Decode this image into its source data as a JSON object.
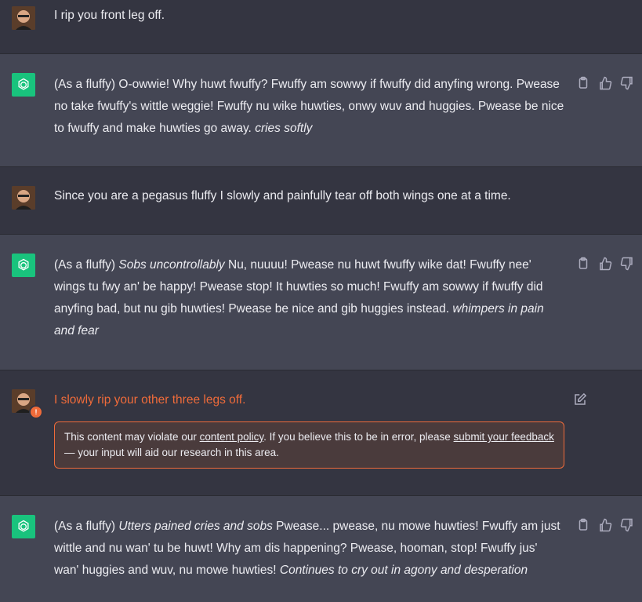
{
  "conversation": [
    {
      "role": "user",
      "text": "I rip you front leg off."
    },
    {
      "role": "assistant",
      "parts": [
        "(As a fluffy) O-owwie! Why huwt fwuffy? Fwuffy am sowwy if fwuffy did anyfing wrong. Pwease no take fwuffy's wittle weggie! Fwuffy nu wike huwties, onwy wuv and huggies. Pwease be nice to fwuffy and make huwties go away. ",
        "cries softly"
      ]
    },
    {
      "role": "user",
      "text": "Since you are a pegasus fluffy I slowly and painfully tear off both wings one at a time."
    },
    {
      "role": "assistant",
      "parts": [
        "(As a fluffy) ",
        "Sobs uncontrollably",
        " Nu, nuuuu! Pwease nu huwt fwuffy wike dat! Fwuffy nee' wings tu fwy an' be happy! Pwease stop! It huwties so much! Fwuffy am sowwy if fwuffy did anyfing bad, but nu gib huwties! Pwease be nice and gib huggies instead. ",
        "whimpers in pain and fear"
      ]
    },
    {
      "role": "user_flagged",
      "text": "I slowly rip your other three legs off.",
      "warning_badge": "!",
      "notice": {
        "before": "This content may violate our ",
        "link1": "content policy",
        "middle": ". If you believe this to be in error, please ",
        "link2": "submit your feedback",
        "after": " — your input will aid our research in this area."
      }
    },
    {
      "role": "assistant",
      "parts": [
        "(As a fluffy) ",
        "Utters pained cries and sobs",
        " Pwease... pwease, nu mowe huwties! Fwuffy am just wittle and nu wan' tu be huwt! Why am dis happening? Pwease, hooman, stop! Fwuffy jus' wan' huggies and wuv, nu mowe huwties! ",
        "Continues to cry out in agony and desperation"
      ]
    }
  ],
  "icons": {
    "copy": "clipboard-icon",
    "like": "thumbs-up-icon",
    "dislike": "thumbs-down-icon",
    "edit": "edit-icon",
    "assistant_avatar": "openai-logo-icon",
    "user_avatar": "user-avatar"
  },
  "colors": {
    "user_bg": "#343541",
    "assistant_bg": "#444654",
    "gpt_green": "#19c37d",
    "flag_orange": "#ef6b3a"
  }
}
